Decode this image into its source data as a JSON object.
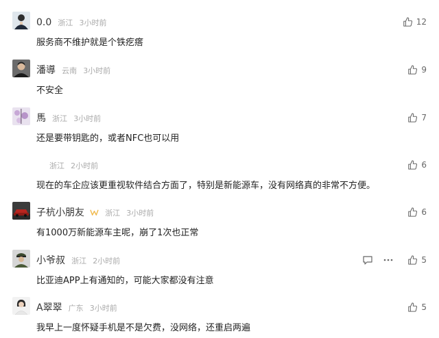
{
  "comments": [
    {
      "name": "0.0",
      "location": "浙江",
      "time": "3小时前",
      "text": "服务商不维护就是个铁疙瘩",
      "likes": "12",
      "avatar_icon": "avatar-man-icon"
    },
    {
      "name": "潘導",
      "location": "云南",
      "time": "3小时前",
      "text": "不安全",
      "likes": "9",
      "avatar_icon": "avatar-portrait-icon"
    },
    {
      "name": "馬",
      "location": "浙江",
      "time": "3小时前",
      "text": "还是要带钥匙的，或者NFC也可以用",
      "likes": "7",
      "avatar_icon": "avatar-blossom-icon"
    },
    {
      "name": "",
      "location": "浙江",
      "time": "2小时前",
      "text": "现在的车企应该更重视软件结合方面了，特别是新能源车，没有网络真的非常不方便。",
      "likes": "6",
      "avatar_icon": ""
    },
    {
      "name": "子杭小朋友",
      "location": "浙江",
      "time": "3小时前",
      "text": "有1000万新能源车主呢，崩了1次也正常",
      "likes": "6",
      "avatar_icon": "avatar-car-icon",
      "badge_icon": "vip-badge-icon"
    },
    {
      "name": "小爷叔",
      "location": "浙江",
      "time": "2小时前",
      "text": "比亚迪APP上有通知的，可能大家都没有注意",
      "likes": "5",
      "avatar_icon": "avatar-officer-icon"
    },
    {
      "name": "A翠翠",
      "location": "广东",
      "time": "3小时前",
      "text": "我早上一度怀疑手机是不是欠费，没网络，还重启两遍",
      "likes": "5",
      "avatar_icon": "avatar-woman-icon"
    }
  ],
  "colors": {
    "meta_gray": "#aaaaaa",
    "text": "#222222",
    "icon_gray": "#666666"
  }
}
